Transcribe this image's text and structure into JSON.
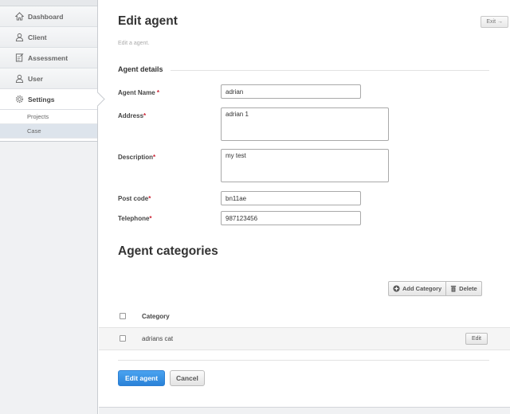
{
  "sidebar": {
    "items": [
      {
        "label": "Dashboard",
        "icon": "home-icon"
      },
      {
        "label": "Client",
        "icon": "user-icon"
      },
      {
        "label": "Assessment",
        "icon": "document-icon"
      },
      {
        "label": "User",
        "icon": "user-icon"
      },
      {
        "label": "Settings",
        "icon": "gear-icon"
      }
    ],
    "sub_items": [
      {
        "label": "Projects"
      },
      {
        "label": "Case"
      }
    ]
  },
  "header": {
    "title": "Edit agent",
    "exit_label": "Exit →",
    "subtitle": "Edit a agent."
  },
  "form": {
    "section_title": "Agent details",
    "fields": {
      "name": {
        "label": "Agent Name",
        "req": "*",
        "value": "adrian"
      },
      "address": {
        "label": "Address",
        "req": "*",
        "value": "adrian 1"
      },
      "description": {
        "label": "Description",
        "req": "*",
        "value": "my test"
      },
      "postcode": {
        "label": "Post code",
        "req": "*",
        "value": "bn11ae"
      },
      "telephone": {
        "label": "Telephone",
        "req": "*",
        "value": "987123456"
      }
    }
  },
  "categories": {
    "title": "Agent categories",
    "add_label": "Add Category",
    "delete_label": "Delete",
    "column_header": "Category",
    "rows": [
      {
        "name": "adrians cat",
        "edit_label": "Edit"
      }
    ]
  },
  "actions": {
    "submit_label": "Edit agent",
    "cancel_label": "Cancel"
  },
  "colors": {
    "primary": "#2a82d8",
    "required": "#cc2233",
    "sidebar_bg": "#f0f1f3"
  }
}
